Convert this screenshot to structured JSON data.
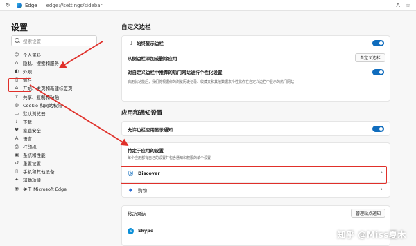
{
  "browser": {
    "origin": "Edge",
    "path": "edge://settings/sidebar"
  },
  "sidebar": {
    "title": "设置",
    "search_placeholder": "搜索设置",
    "items": [
      {
        "label": "个人资料",
        "icon": "person-icon"
      },
      {
        "label": "隐私、搜索和服务",
        "icon": "lock-icon"
      },
      {
        "label": "外观",
        "icon": "appearance-icon"
      },
      {
        "label": "侧栏",
        "icon": "sidebar-icon",
        "active": true
      },
      {
        "label": "开始、主页和新建标签页",
        "icon": "home-icon"
      },
      {
        "label": "共享、复制和粘贴",
        "icon": "share-icon"
      },
      {
        "label": "Cookie 和网站权限",
        "icon": "cookie-icon"
      },
      {
        "label": "默认浏览器",
        "icon": "browser-icon"
      },
      {
        "label": "下载",
        "icon": "download-icon"
      },
      {
        "label": "家庭安全",
        "icon": "family-icon"
      },
      {
        "label": "语言",
        "icon": "language-icon"
      },
      {
        "label": "打印机",
        "icon": "printer-icon"
      },
      {
        "label": "系统和性能",
        "icon": "system-icon"
      },
      {
        "label": "重置设置",
        "icon": "reset-icon"
      },
      {
        "label": "手机和其他设备",
        "icon": "phone-icon"
      },
      {
        "label": "辅助功能",
        "icon": "accessibility-icon"
      },
      {
        "label": "关于 Microsoft Edge",
        "icon": "edge-icon"
      }
    ]
  },
  "main": {
    "section1": {
      "title": "自定义边栏",
      "always_show": "始终显示边栏",
      "add_remove": "从侧边栏添加或删除应用",
      "customize_button": "自定义边栏",
      "personalize_label": "对自定义边栏中推荐的热门网站进行个性化设置",
      "personalize_sub": "启用此功能后，我们将根据你的浏览历史记录、收藏夹和其他数据来个性化你在自定义边栏中显示的热门网站"
    },
    "section2": {
      "title": "应用和通知设置",
      "allow_notify": "允许边栏应用显示通知",
      "app_specific_title": "特定于应用的设置",
      "app_specific_sub": "每个应用都有自己的设置并包含通知和权限的单个设置",
      "apps": [
        {
          "name": "Discover",
          "icon": "discover-icon"
        },
        {
          "name": "购物",
          "icon": "shopping-icon"
        }
      ],
      "mobile_label": "移动网站",
      "manage_button": "管理站点通知",
      "skype": "Skype"
    }
  },
  "watermark": "知乎 @Miss夏木",
  "colors": {
    "accent": "#0f6cbd",
    "highlight": "#e0302a"
  }
}
